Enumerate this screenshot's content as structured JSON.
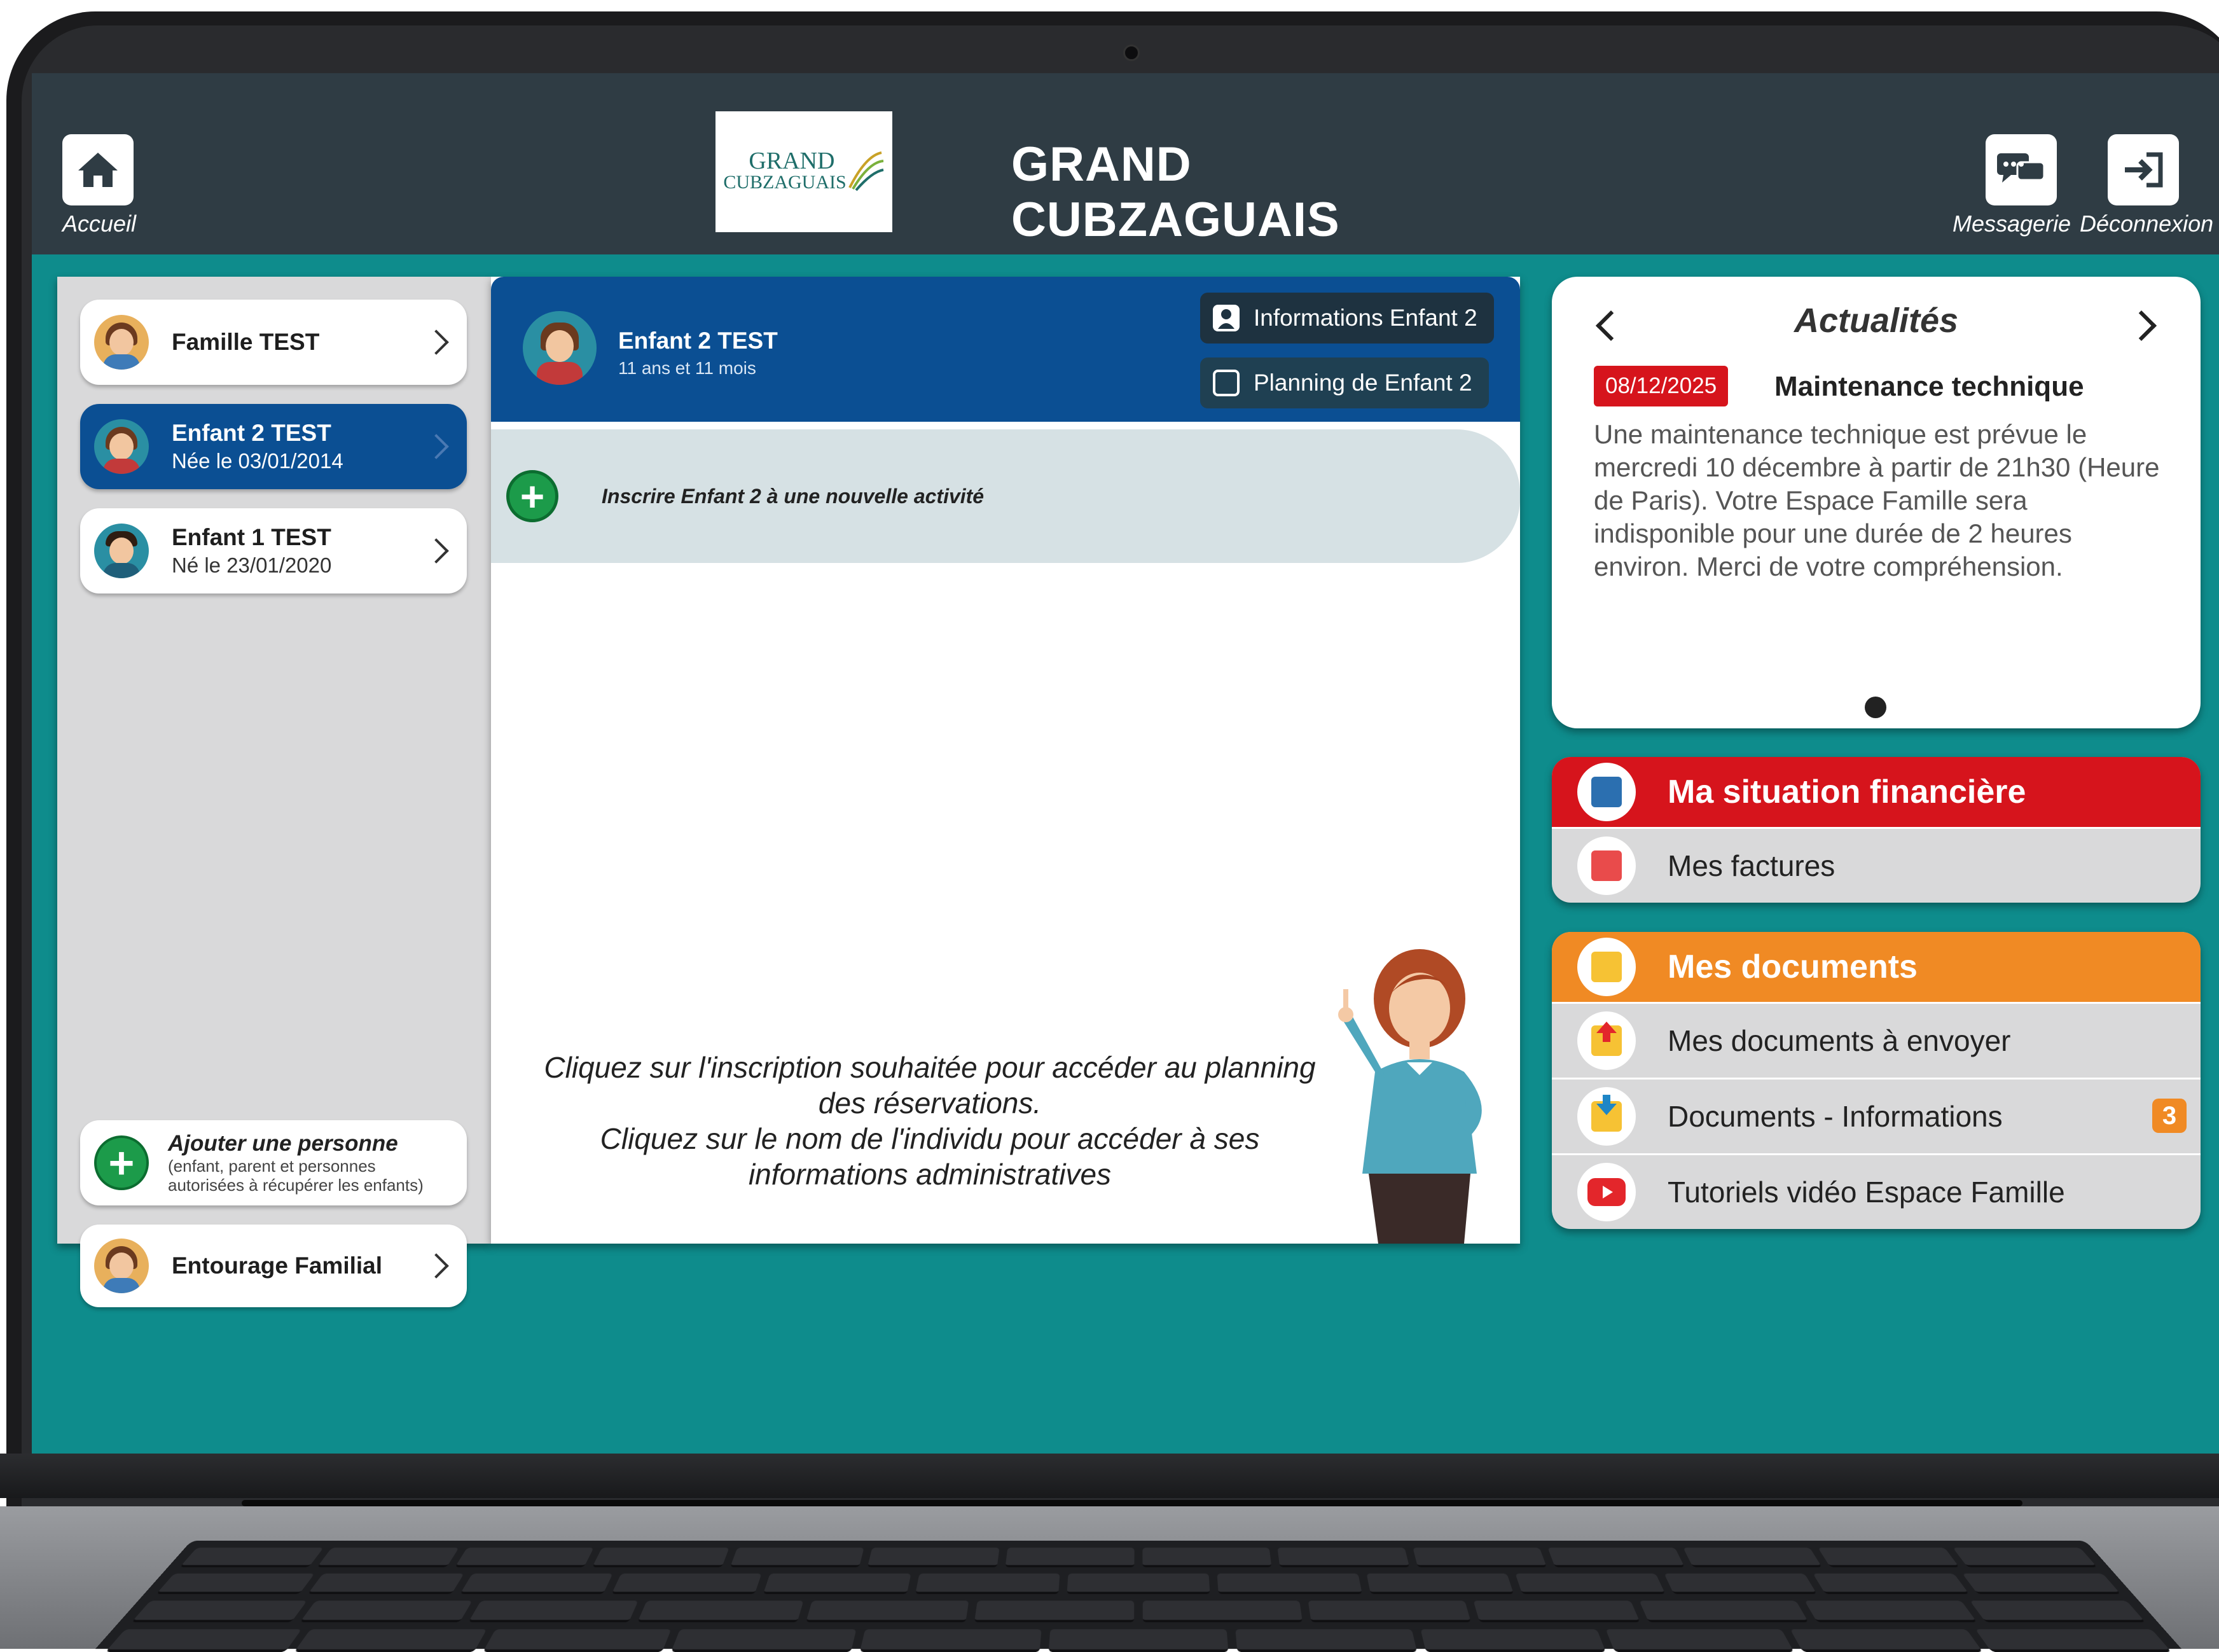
{
  "header": {
    "home_label": "Accueil",
    "logo_text_line1": "GRAND",
    "logo_text_line2": "CUBZAGUAIS",
    "title": "GRAND CUBZAGUAIS",
    "messaging_label": "Messagerie",
    "logout_label": "Déconnexion"
  },
  "sidebar": {
    "family": {
      "name": "Famille TEST"
    },
    "children": [
      {
        "name": "Enfant 2 TEST",
        "birth": "Née le 03/01/2014",
        "active": true
      },
      {
        "name": "Enfant 1 TEST",
        "birth": "Né le 23/01/2020",
        "active": false
      }
    ],
    "add_person": {
      "title": "Ajouter une personne",
      "subtitle_line1": "(enfant, parent et personnes",
      "subtitle_line2": "autorisées à récupérer les enfants)"
    },
    "entourage": {
      "label": "Entourage Familial"
    }
  },
  "child_panel": {
    "name": "Enfant 2 TEST",
    "age": "11 ans et 11 mois",
    "info_button": "Informations Enfant 2",
    "planning_button": "Planning de Enfant 2",
    "enroll_label": "Inscrire Enfant 2 à une nouvelle activité",
    "instructions_line1": "Cliquez sur l'inscription souhaitée pour accéder au planning",
    "instructions_line2": "des réservations.",
    "instructions_line3": "Cliquez sur le nom de l'individu pour accéder à ses",
    "instructions_line4": "informations administratives"
  },
  "news": {
    "title": "Actualités",
    "date": "08/12/2025",
    "headline": "Maintenance technique",
    "body": "Une maintenance technique est prévue le mercredi 10 décembre à partir de 21h30 (Heure de Paris). Votre Espace Famille sera indisponible pour une durée de 2 heures environ. Merci de votre compréhension."
  },
  "finance": {
    "title": "Ma situation financière",
    "items": [
      {
        "label": "Mes factures"
      }
    ]
  },
  "documents": {
    "title": "Mes documents",
    "items": [
      {
        "label": "Mes documents à envoyer"
      },
      {
        "label": "Documents - Informations",
        "badge": "3"
      },
      {
        "label": "Tutoriels vidéo Espace Famille"
      }
    ]
  },
  "colors": {
    "background_teal": "#0e8c8c",
    "header_dark": "#2f3c44",
    "primary_blue": "#0b4f93",
    "finance_red": "#d6141c",
    "documents_orange": "#f08a24",
    "add_green": "#1c9b4a"
  },
  "icons": [
    "home-icon",
    "messaging-icon",
    "logout-icon",
    "chevron-right-icon",
    "plus-icon",
    "user-icon",
    "calendar-icon",
    "arrow-left-icon",
    "arrow-right-icon",
    "invoice-icon",
    "folder-icon",
    "upload-icon",
    "download-icon",
    "youtube-icon"
  ]
}
